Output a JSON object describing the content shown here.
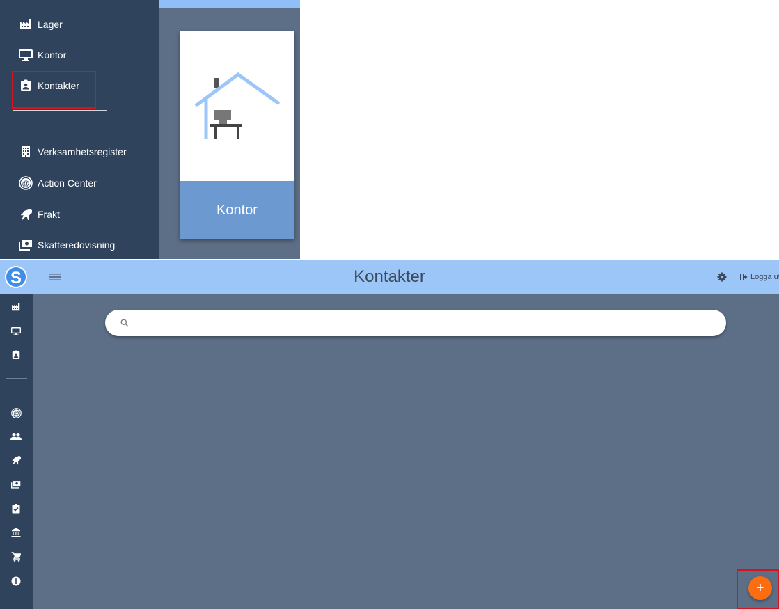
{
  "top_inset": {
    "nav_items": [
      {
        "label": "Lager",
        "icon": "warehouse-icon"
      },
      {
        "label": "Kontor",
        "icon": "monitor-icon"
      },
      {
        "label": "Kontakter",
        "icon": "contact-badge-icon"
      },
      {
        "label": "Verksamhetsregister",
        "icon": "building-icon"
      },
      {
        "label": "Action Center",
        "icon": "at-sign-icon"
      },
      {
        "label": "Frakt",
        "icon": "horse-icon"
      },
      {
        "label": "Skatteredovisning",
        "icon": "money-icon"
      }
    ],
    "card": {
      "label": "Kontor",
      "image": "house-office-illustration"
    }
  },
  "header": {
    "title": "Kontakter",
    "logout_label": "Logga ut",
    "settings_icon": "gear-icon",
    "menu_icon": "hamburger-icon"
  },
  "sidebar": {
    "icons": [
      "warehouse-icon",
      "monitor-icon",
      "contact-badge-icon",
      "at-sign-icon",
      "group-icon",
      "horse-icon",
      "money-icon",
      "clipboard-check-icon",
      "bank-icon",
      "cart-icon",
      "info-icon"
    ]
  },
  "search": {
    "placeholder": "",
    "value": ""
  },
  "fab": {
    "label": "+"
  },
  "colors": {
    "header": "#9cc5f8",
    "sidebar": "#2f445c",
    "content": "#5d6f87",
    "card_footer": "#6b99d0",
    "fab": "#fb6d10",
    "highlight": "#d6121c"
  }
}
